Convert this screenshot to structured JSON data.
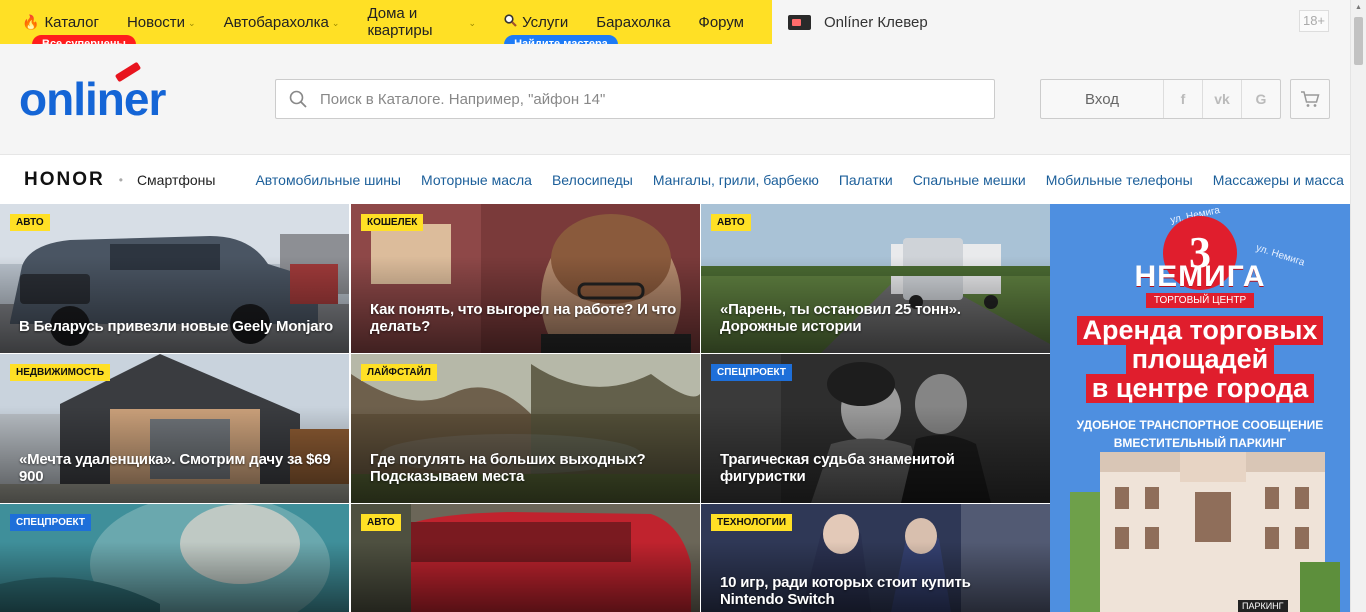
{
  "topbar": {
    "nav": [
      {
        "label": "Каталог",
        "icon": "flame-icon",
        "caret": false,
        "badge": "Все суперцены"
      },
      {
        "label": "Новости",
        "caret": true
      },
      {
        "label": "Автобарахолка",
        "caret": true
      },
      {
        "label": "Дома и квартиры",
        "caret": true
      },
      {
        "label": "Услуги",
        "icon": "search-icon",
        "caret": false,
        "badge": "Найдите мастера"
      },
      {
        "label": "Барахолка",
        "caret": false
      },
      {
        "label": "Форум",
        "caret": false
      }
    ],
    "clever": "Onlíner Клевер",
    "age": "18+",
    "colors": {
      "yellow": "#ffe025",
      "red_pill": "#ff1d1d",
      "blue_pill": "#1e7bf6"
    }
  },
  "header": {
    "logo": "onliner",
    "search_placeholder": "Поиск в Каталоге. Например, \"айфон 14\"",
    "login": "Вход",
    "social": [
      "f",
      "vk",
      "G"
    ]
  },
  "catstrip": {
    "brand": "HONOR",
    "brand_sub": "Смартфоны",
    "links": [
      "Автомобильные шины",
      "Моторные масла",
      "Велосипеды",
      "Мангалы, грили, барбекю",
      "Палатки",
      "Спальные мешки",
      "Мобильные телефоны",
      "Массажеры и масса"
    ]
  },
  "news": [
    {
      "badge": "Авто",
      "style": "y",
      "title": "В Беларусь привезли новые Geely Monjaro",
      "art": "car"
    },
    {
      "badge": "Кошелек",
      "style": "y",
      "title": "Как понять, что выгорел на работе? И что делать?",
      "art": "woman"
    },
    {
      "badge": "Авто",
      "style": "y",
      "title": "«Парень, ты остановил 25 тонн». Дорожные истории",
      "art": "truck"
    },
    {
      "badge": "Недвижимость",
      "style": "y",
      "title": "«Мечта удаленщика». Смотрим дачу за $69 900",
      "art": "house"
    },
    {
      "badge": "Лайфстайл",
      "style": "y",
      "title": "Где погулять на больших выходных? Подсказываем места",
      "art": "park"
    },
    {
      "badge": "Спецпроект",
      "style": "b",
      "title": "Трагическая судьба знаменитой фигуристки",
      "art": "bw"
    },
    {
      "badge": "Спецпроект",
      "style": "b",
      "title": "",
      "art": "water"
    },
    {
      "badge": "Авто",
      "style": "y",
      "title": "",
      "art": "redcar"
    },
    {
      "badge": "Технологии",
      "style": "y",
      "title": "10 игр, ради которых стоит купить Nintendo Switch",
      "art": "game"
    }
  ],
  "ad": {
    "number": "3",
    "name": "НЕМИГА",
    "tc": "ТОРГОВЫЙ ЦЕНТР",
    "headline": [
      "Аренда торговых",
      "площадей",
      "в центре города"
    ],
    "sub": [
      "УДОБНОЕ ТРАНСПОРТНОЕ СООБЩЕНИЕ",
      "ВМЕСТИТЕЛЬНЫЙ ПАРКИНГ"
    ],
    "street1": "ул. Немига",
    "street2": "ул. Немига",
    "parking": "ПАРКИНГ"
  }
}
